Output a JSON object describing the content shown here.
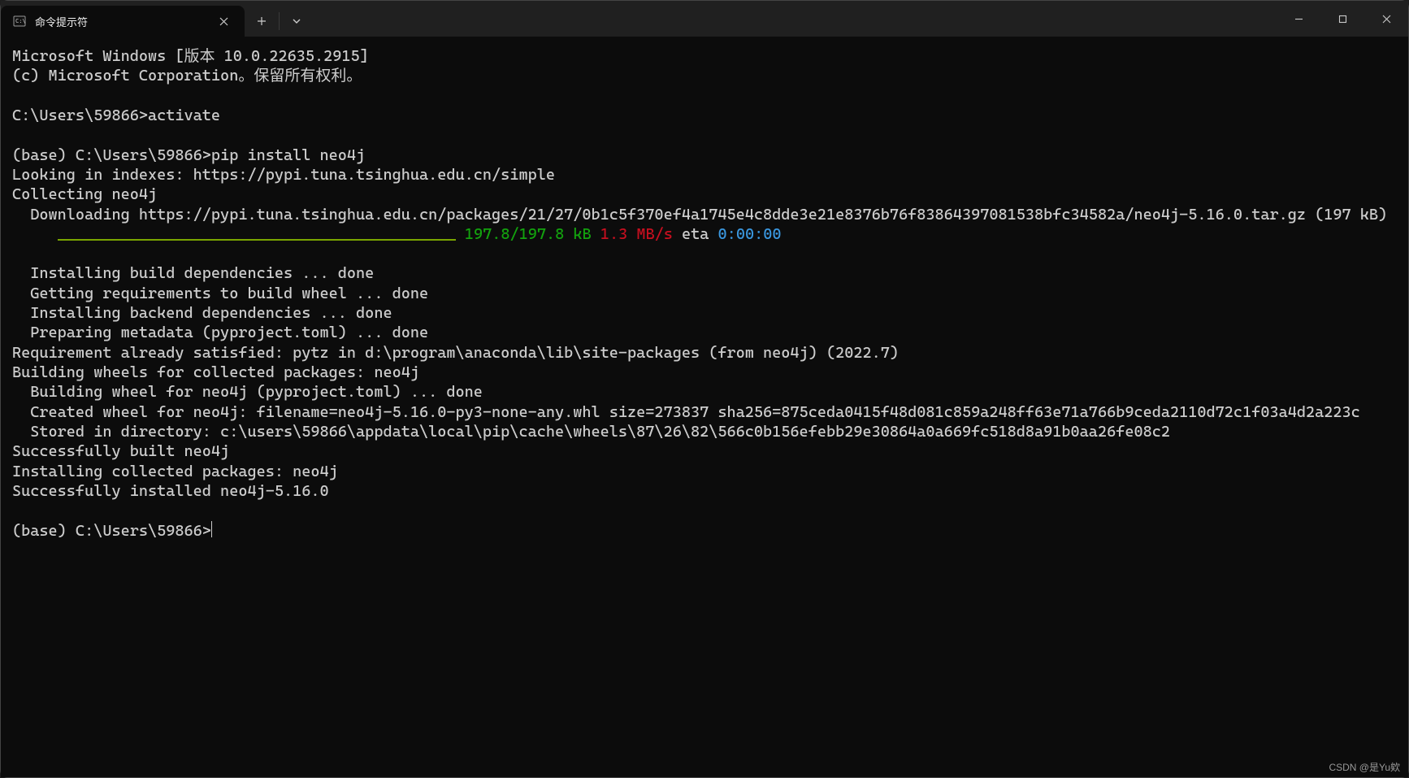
{
  "titlebar": {
    "tab_title": "命令提示符",
    "tab_icon": "terminal-icon",
    "close_tab": "✕",
    "new_tab": "＋",
    "dropdown": "⌄"
  },
  "window_controls": {
    "minimize": "—",
    "maximize": "□",
    "close": "✕"
  },
  "terminal": {
    "line1": "Microsoft Windows [版本 10.0.22635.2915]",
    "line2": "(c) Microsoft Corporation。保留所有权利。",
    "prompt1": "C:\\Users\\59866>",
    "cmd1": "activate",
    "prompt2": "(base) C:\\Users\\59866>",
    "cmd2": "pip install neo4j",
    "out1": "Looking in indexes: https://pypi.tuna.tsinghua.edu.cn/simple",
    "out2": "Collecting neo4j",
    "out3": "  Downloading https://pypi.tuna.tsinghua.edu.cn/packages/21/27/0b1c5f370ef4a1745e4c8dde3e21e8376b76f83864397081538bfc34582a/neo4j-5.16.0.tar.gz (197 kB)",
    "progress_pad": "     ",
    "progress_size": " 197.8/197.8 kB",
    "progress_speed": " 1.3 MB/s",
    "progress_eta_label": " eta ",
    "progress_eta": "0:00:00",
    "out4": "  Installing build dependencies ... done",
    "out5": "  Getting requirements to build wheel ... done",
    "out6": "  Installing backend dependencies ... done",
    "out7": "  Preparing metadata (pyproject.toml) ... done",
    "out8": "Requirement already satisfied: pytz in d:\\program\\anaconda\\lib\\site-packages (from neo4j) (2022.7)",
    "out9": "Building wheels for collected packages: neo4j",
    "out10": "  Building wheel for neo4j (pyproject.toml) ... done",
    "out11": "  Created wheel for neo4j: filename=neo4j-5.16.0-py3-none-any.whl size=273837 sha256=875ceda0415f48d081c859a248ff63e71a766b9ceda2110d72c1f03a4d2a223c",
    "out12": "  Stored in directory: c:\\users\\59866\\appdata\\local\\pip\\cache\\wheels\\87\\26\\82\\566c0b156efebb29e30864a0a669fc518d8a91b0aa26fe08c2",
    "out13": "Successfully built neo4j",
    "out14": "Installing collected packages: neo4j",
    "out15": "Successfully installed neo4j-5.16.0",
    "prompt3": "(base) C:\\Users\\59866>"
  },
  "watermark": "CSDN @是Yu欸"
}
